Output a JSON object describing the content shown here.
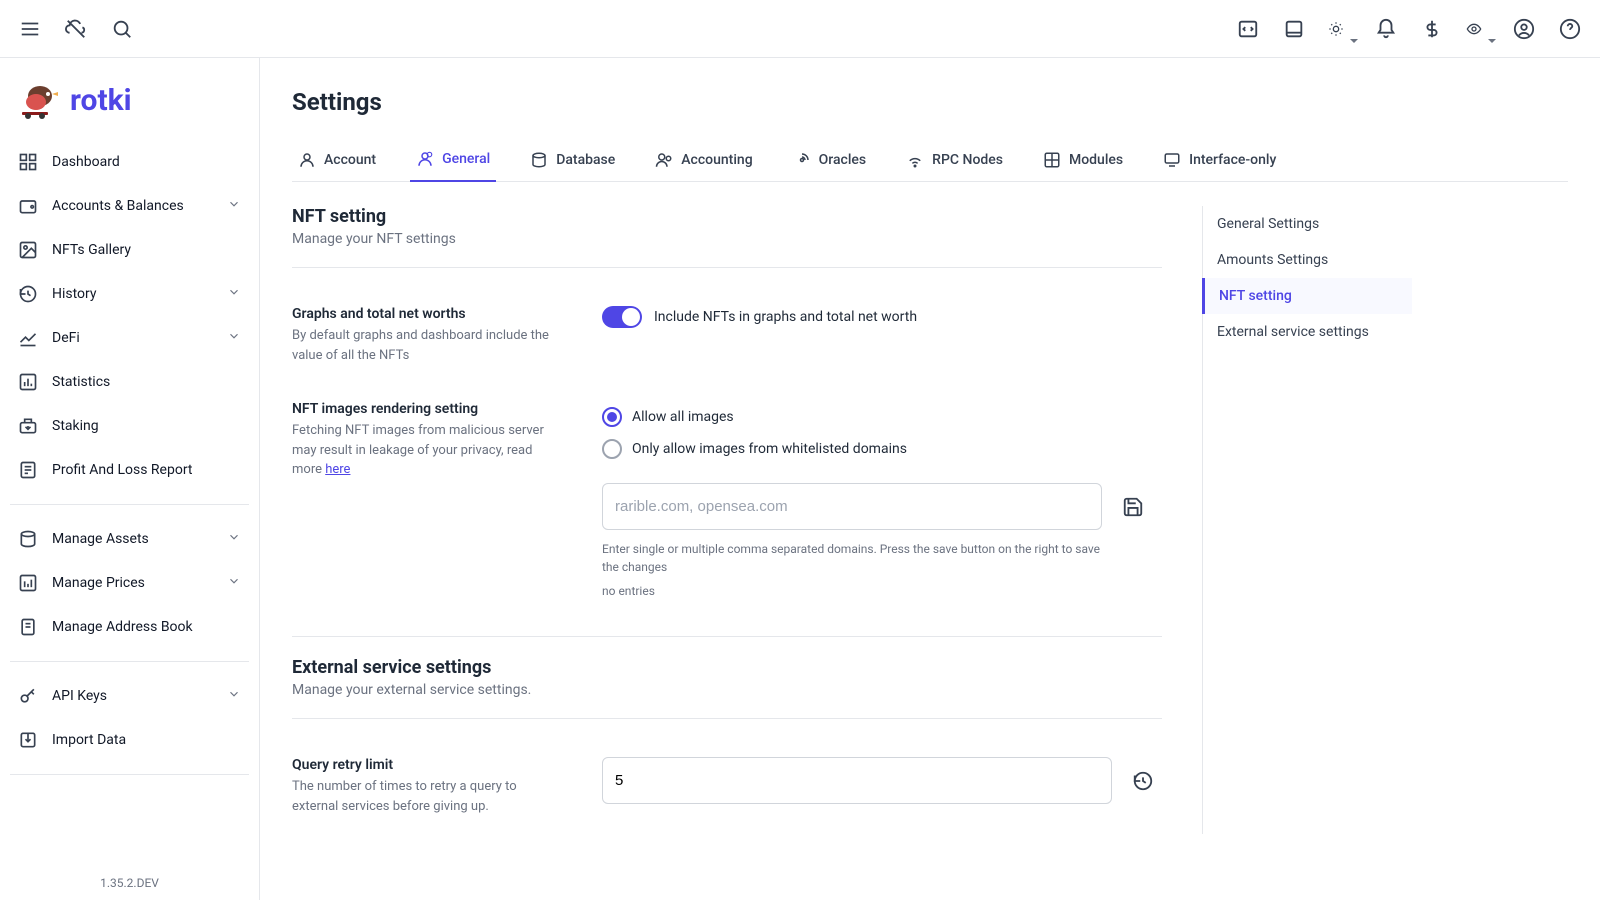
{
  "brand": {
    "name": "rotki"
  },
  "version": "1.35.2.DEV",
  "page": {
    "title": "Settings"
  },
  "sidebar": {
    "items": [
      {
        "label": "Dashboard"
      },
      {
        "label": "Accounts & Balances",
        "expandable": true
      },
      {
        "label": "NFTs Gallery"
      },
      {
        "label": "History",
        "expandable": true
      },
      {
        "label": "DeFi",
        "expandable": true
      },
      {
        "label": "Statistics"
      },
      {
        "label": "Staking"
      },
      {
        "label": "Profit And Loss Report"
      }
    ],
    "items2": [
      {
        "label": "Manage Assets",
        "expandable": true
      },
      {
        "label": "Manage Prices",
        "expandable": true
      },
      {
        "label": "Manage Address Book"
      }
    ],
    "items3": [
      {
        "label": "API Keys",
        "expandable": true
      },
      {
        "label": "Import Data"
      }
    ]
  },
  "tabs": [
    {
      "label": "Account"
    },
    {
      "label": "General",
      "active": true
    },
    {
      "label": "Database"
    },
    {
      "label": "Accounting"
    },
    {
      "label": "Oracles"
    },
    {
      "label": "RPC Nodes"
    },
    {
      "label": "Modules"
    },
    {
      "label": "Interface-only"
    }
  ],
  "rightnav": [
    {
      "label": "General Settings"
    },
    {
      "label": "Amounts Settings"
    },
    {
      "label": "NFT setting",
      "active": true
    },
    {
      "label": "External service settings"
    }
  ],
  "nft": {
    "title": "NFT setting",
    "sub": "Manage your NFT settings",
    "row1": {
      "title": "Graphs and total net worths",
      "desc": "By default graphs and dashboard include the value of all the NFTs",
      "toggle_label": "Include NFTs in graphs and total net worth"
    },
    "row2": {
      "title": "NFT images rendering setting",
      "desc_prefix": "Fetching NFT images from malicious server may result in leakage of your privacy, read more ",
      "desc_link": "here",
      "radio_all": "Allow all images",
      "radio_whitelist": "Only allow images from whitelisted domains",
      "placeholder": "rarible.com, opensea.com",
      "helper": "Enter single or multiple comma separated domains. Press the save button on the right to save the changes",
      "no_entries": "no entries"
    }
  },
  "ext": {
    "title": "External service settings",
    "sub": "Manage your external service settings.",
    "row1": {
      "title": "Query retry limit",
      "desc": "The number of times to retry a query to external services before giving up.",
      "value": "5"
    }
  }
}
